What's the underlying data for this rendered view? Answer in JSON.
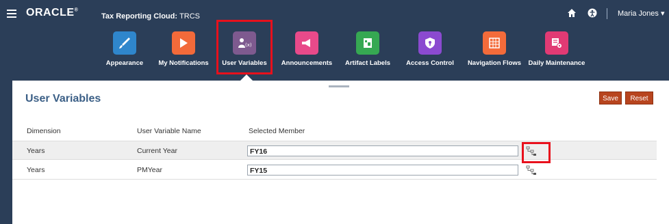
{
  "header": {
    "logo": "ORACLE",
    "app_title": "Tax Reporting Cloud:",
    "app_subtitle": "TRCS",
    "user_name": "Maria Jones",
    "user_caret": "▾"
  },
  "nav": {
    "tiles": [
      {
        "label": "Appearance",
        "icon": "paintbrush-icon",
        "color": "#2f86cc"
      },
      {
        "label": "My Notifications",
        "icon": "notification-play-icon",
        "color": "#f26a3a"
      },
      {
        "label": "User Variables",
        "icon": "user-variable-icon",
        "color": "#7e5a8f"
      },
      {
        "label": "Announcements",
        "icon": "megaphone-icon",
        "color": "#e84a8a"
      },
      {
        "label": "Artifact Labels",
        "icon": "label-icon",
        "color": "#36a852"
      },
      {
        "label": "Access Control",
        "icon": "shield-icon",
        "color": "#8b4ad0"
      },
      {
        "label": "Navigation Flows",
        "icon": "flow-grid-icon",
        "color": "#f36b3a"
      },
      {
        "label": "Daily Maintenance",
        "icon": "maintenance-gear-icon",
        "color": "#e13a74"
      }
    ]
  },
  "page": {
    "title": "User Variables",
    "save_label": "Save",
    "reset_label": "Reset",
    "columns": [
      "Dimension",
      "User Variable Name",
      "Selected Member"
    ],
    "rows": [
      {
        "dimension": "Years",
        "variable": "Current Year",
        "member": "FY16"
      },
      {
        "dimension": "Years",
        "variable": "PMYear",
        "member": "FY15"
      }
    ]
  },
  "colors": {
    "header_bg": "#2b3e58",
    "highlight": "#e8101c",
    "button": "#b8451f",
    "title": "#3b5f86"
  }
}
